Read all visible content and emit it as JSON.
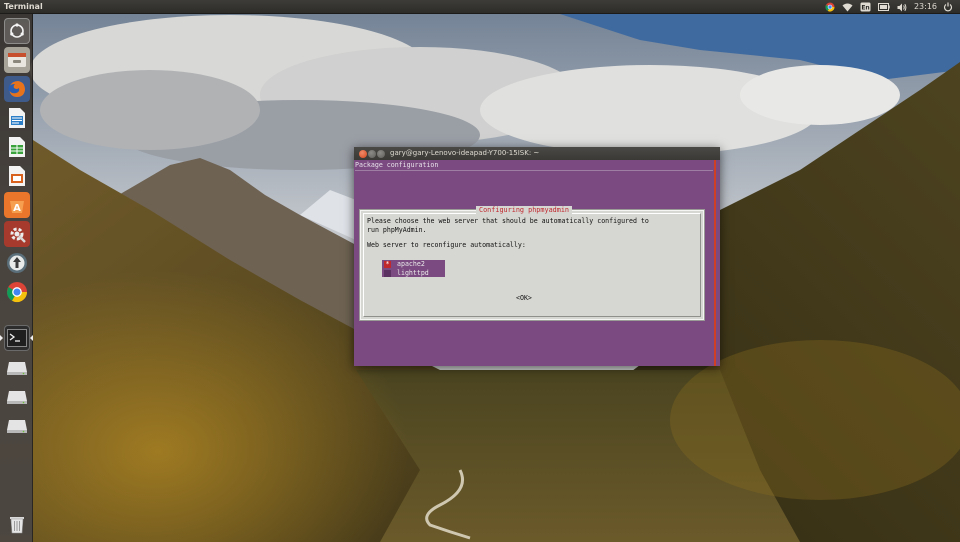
{
  "top_panel": {
    "app_title": "Terminal",
    "clock": "23:16",
    "indicators": [
      "chrome-icon",
      "wifi-icon",
      "keyboard-icon",
      "battery-icon",
      "volume-icon",
      "power-icon"
    ],
    "keyboard_label": "En"
  },
  "launcher": {
    "items": [
      {
        "name": "dash-icon"
      },
      {
        "name": "files-icon"
      },
      {
        "name": "firefox-icon"
      },
      {
        "name": "writer-icon"
      },
      {
        "name": "calc-icon"
      },
      {
        "name": "impress-icon"
      },
      {
        "name": "software-center-icon"
      },
      {
        "name": "settings-icon"
      },
      {
        "name": "updater-icon"
      },
      {
        "name": "chrome-icon"
      },
      {
        "name": "terminal-icon"
      },
      {
        "name": "drive-icon"
      },
      {
        "name": "drive-icon"
      },
      {
        "name": "drive-icon"
      },
      {
        "name": "trash-icon"
      }
    ]
  },
  "terminal": {
    "title": "gary@gary-Lenovo-ideapad-Y700-15ISK: ~",
    "header": "Package configuration",
    "dialog": {
      "title": "Configuring phpmyadmin",
      "message": "Please choose the web server that should be automatically configured to\nrun phpMyAdmin.",
      "prompt": "Web server to reconfigure automatically:",
      "options": [
        {
          "label": "apache2",
          "checked": true
        },
        {
          "label": "lighttpd",
          "checked": false
        }
      ],
      "ok_label": "<OK>",
      "check_mark": "*"
    }
  },
  "colors": {
    "terminal_bg": "#7a4a80",
    "dialog_bg": "#d6d6d2",
    "dialog_title": "#c0282d",
    "accent": "#d03f24"
  }
}
